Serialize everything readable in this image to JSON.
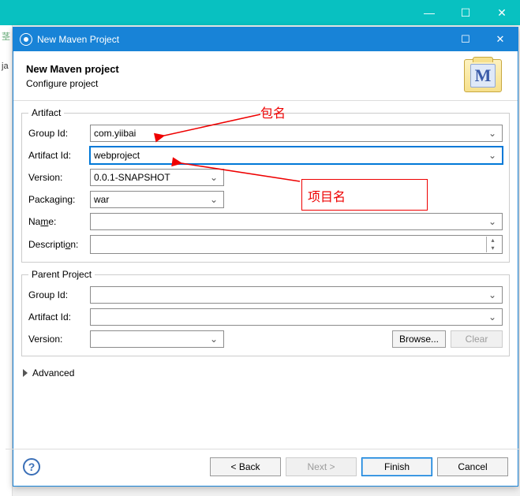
{
  "outer_window": {
    "minimize": "—",
    "maximize": "☐",
    "close": "✕"
  },
  "dialog": {
    "title": "New Maven Project",
    "banner_title": "New Maven project",
    "banner_sub": "Configure project",
    "icon_letter": "M"
  },
  "artifact": {
    "legend": "Artifact",
    "group_id_label": "Group Id:",
    "group_id": "com.yiibai",
    "artifact_id_label": "Artifact Id:",
    "artifact_id": "webproject",
    "version_label": "Version:",
    "version": "0.0.1-SNAPSHOT",
    "packaging_label": "Packaging:",
    "packaging": "war",
    "name_label": "Name:",
    "name": "",
    "desc_label": "Description:",
    "desc": ""
  },
  "parent": {
    "legend": "Parent Project",
    "group_id_label": "Group Id:",
    "group_id": "",
    "artifact_id_label": "Artifact Id:",
    "artifact_id": "",
    "version_label": "Version:",
    "version": "",
    "browse": "Browse...",
    "clear": "Clear"
  },
  "advanced_label": "Advanced",
  "buttons": {
    "back": "< Back",
    "next": "Next >",
    "finish": "Finish",
    "cancel": "Cancel"
  },
  "annotations": {
    "pkg": "包名",
    "proj": "项目名"
  }
}
